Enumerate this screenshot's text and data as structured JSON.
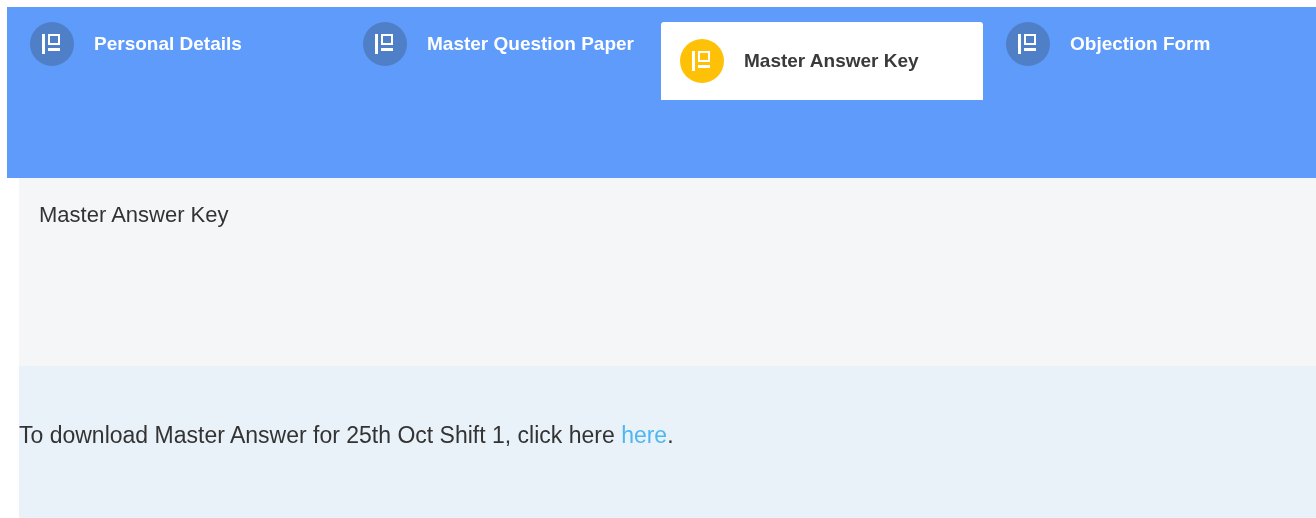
{
  "tabs": [
    {
      "label": "Personal Details",
      "selected": false
    },
    {
      "label": "Master Question Paper",
      "selected": false
    },
    {
      "label": "Master Answer Key",
      "selected": true
    },
    {
      "label": "Objection Form",
      "selected": false
    }
  ],
  "panel": {
    "title": "Master Answer Key"
  },
  "notice": {
    "text": "To download Master Answer for 25th Oct Shift 1, click here ",
    "link": "here",
    "after": "."
  }
}
